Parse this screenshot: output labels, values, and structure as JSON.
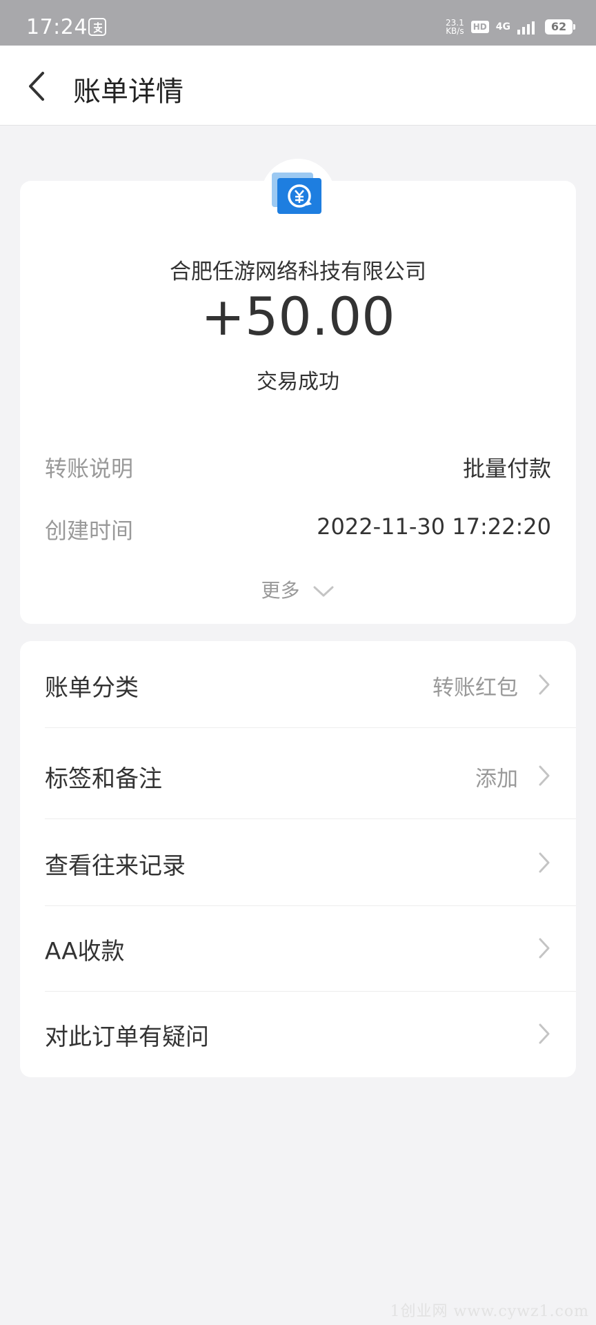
{
  "status_bar": {
    "time": "17:24",
    "app_icon": "alipay-icon",
    "net_speed_value": "23.1",
    "net_speed_unit": "KB/s",
    "hd": "HD",
    "network": "4G",
    "battery": "62"
  },
  "nav": {
    "back_icon": "chevron-left-icon",
    "title": "账单详情"
  },
  "transaction": {
    "icon": "transfer-icon",
    "company": "合肥任游网络科技有限公司",
    "amount": "+50.00",
    "status": "交易成功",
    "details": [
      {
        "label": "转账说明",
        "value": "批量付款"
      },
      {
        "label": "创建时间",
        "value": "2022-11-30 17:22:20"
      }
    ],
    "more_label": "更多"
  },
  "list": [
    {
      "label": "账单分类",
      "value": "转账红包"
    },
    {
      "label": "标签和备注",
      "value": "添加"
    },
    {
      "label": "查看往来记录",
      "value": ""
    },
    {
      "label": "AA收款",
      "value": ""
    },
    {
      "label": "对此订单有疑问",
      "value": ""
    }
  ],
  "watermark": "1创业网 www.cywz1.com",
  "colors": {
    "status_bar_bg": "#a8a8ab",
    "page_bg": "#f3f3f5",
    "icon_blue": "#1e7ee0"
  }
}
